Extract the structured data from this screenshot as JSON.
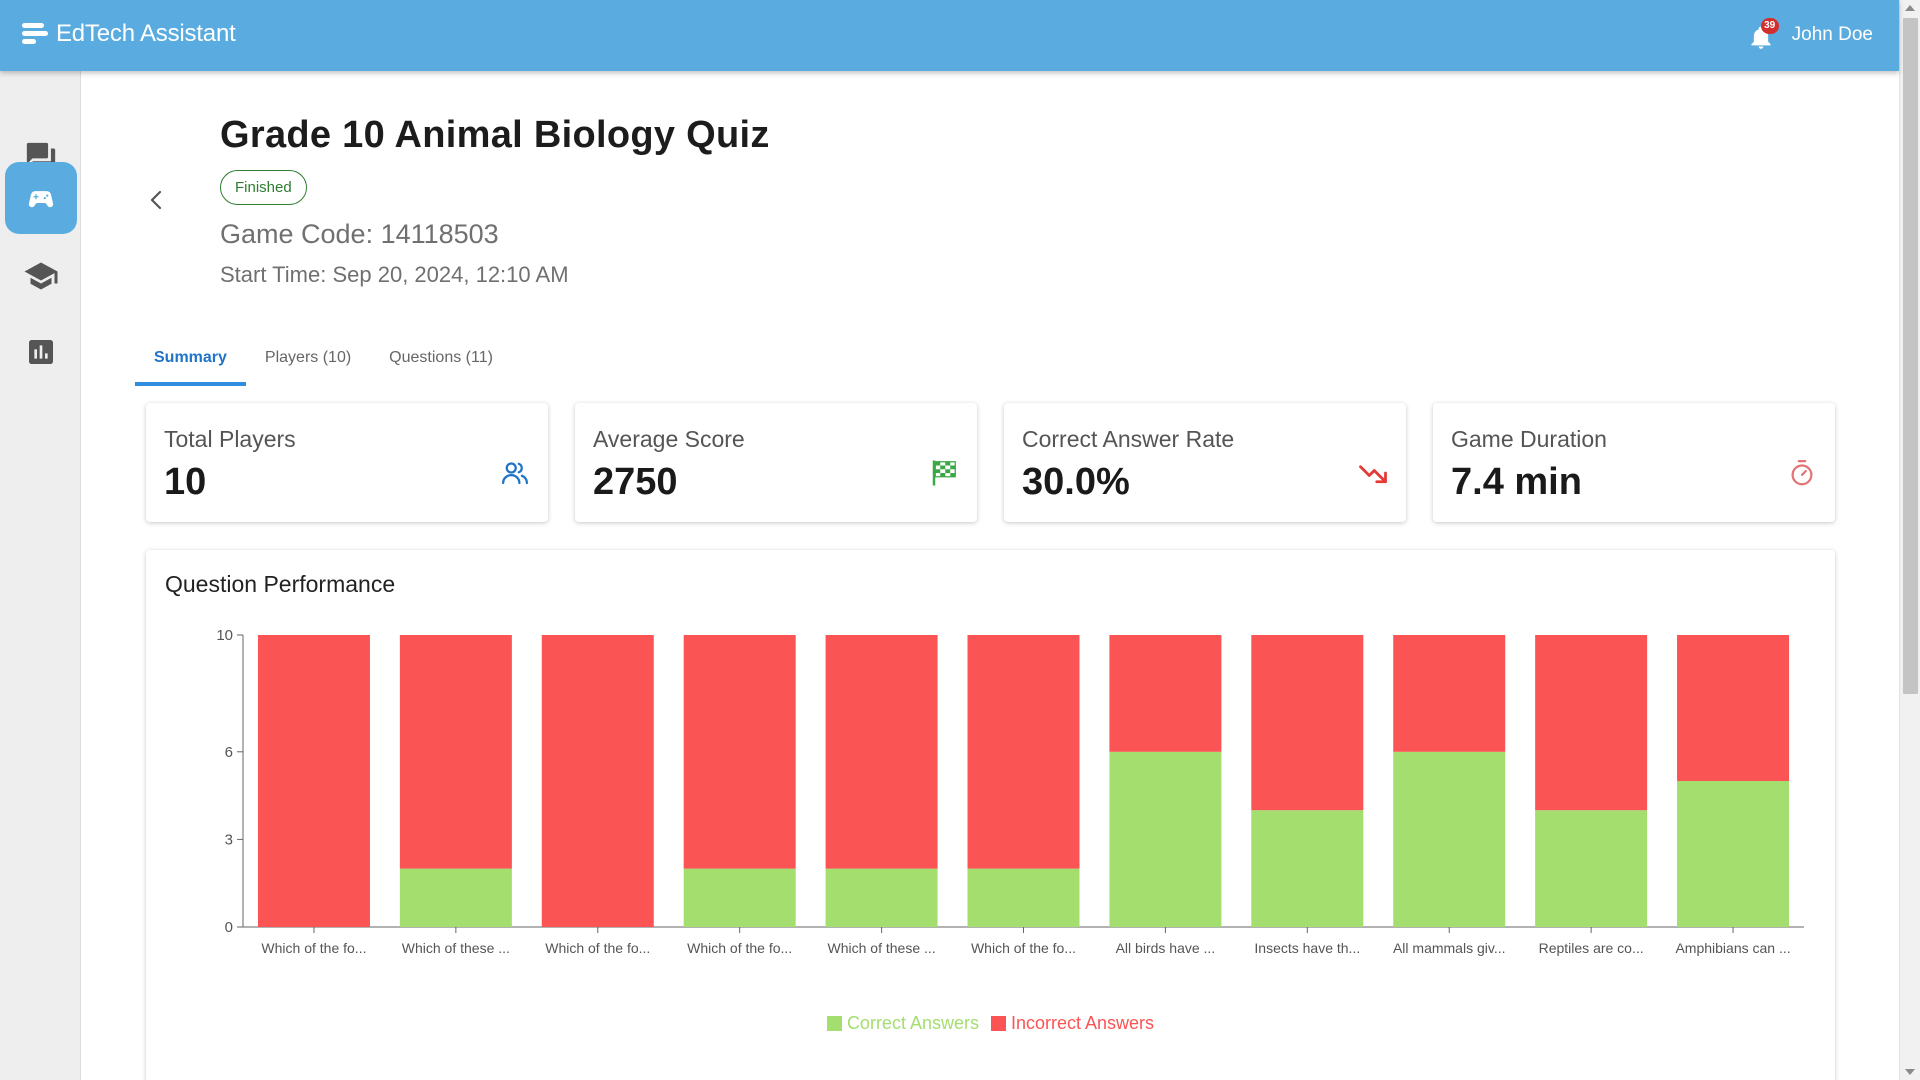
{
  "app": {
    "title": "EdTech Assistant"
  },
  "header": {
    "notification_count": "39",
    "user_name": "John Doe"
  },
  "sidebar": {
    "items": [
      {
        "icon": "chat-icon",
        "active": false
      },
      {
        "icon": "gamepad-icon",
        "active": true
      },
      {
        "icon": "graduation-cap-icon",
        "active": false
      },
      {
        "icon": "bar-chart-icon",
        "active": false
      }
    ]
  },
  "game": {
    "title": "Grade 10 Animal Biology Quiz",
    "status": "Finished",
    "code_label": "Game Code: 14118503",
    "start_time_label": "Start Time: Sep 20, 2024, 12:10 AM"
  },
  "tabs": [
    {
      "label": "Summary",
      "active": true
    },
    {
      "label": "Players (10)",
      "active": false
    },
    {
      "label": "Questions (11)",
      "active": false
    }
  ],
  "stats": [
    {
      "label": "Total Players",
      "value": "10",
      "icon": "users-icon",
      "color": "#1e74c8"
    },
    {
      "label": "Average Score",
      "value": "2750",
      "icon": "checkered-flag-icon",
      "color": "#3aa845"
    },
    {
      "label": "Correct Answer Rate",
      "value": "30.0%",
      "icon": "trending-down-icon",
      "color": "#e53935"
    },
    {
      "label": "Game Duration",
      "value": "7.4 min",
      "icon": "stopwatch-icon",
      "color": "#e57373"
    }
  ],
  "chart_card": {
    "title": "Question Performance"
  },
  "chart_data": {
    "type": "bar",
    "stacked": true,
    "categories": [
      "Which of the fo...",
      "Which of these ...",
      "Which of the fo...",
      "Which of the fo...",
      "Which of these ...",
      "Which of the fo...",
      "All birds have ...",
      "Insects have th...",
      "All mammals giv...",
      "Reptiles are co...",
      "Amphibians can ..."
    ],
    "series": [
      {
        "name": "Correct Answers",
        "color": "#a3de6f",
        "values": [
          0,
          2,
          0,
          2,
          2,
          2,
          6,
          4,
          6,
          4,
          5
        ]
      },
      {
        "name": "Incorrect Answers",
        "color": "#fa5454",
        "values": [
          10,
          8,
          10,
          8,
          8,
          8,
          4,
          6,
          4,
          6,
          5
        ]
      }
    ],
    "yticks": [
      0,
      3,
      6,
      10
    ],
    "ylim": [
      0,
      10
    ],
    "legend_position": "bottom"
  }
}
